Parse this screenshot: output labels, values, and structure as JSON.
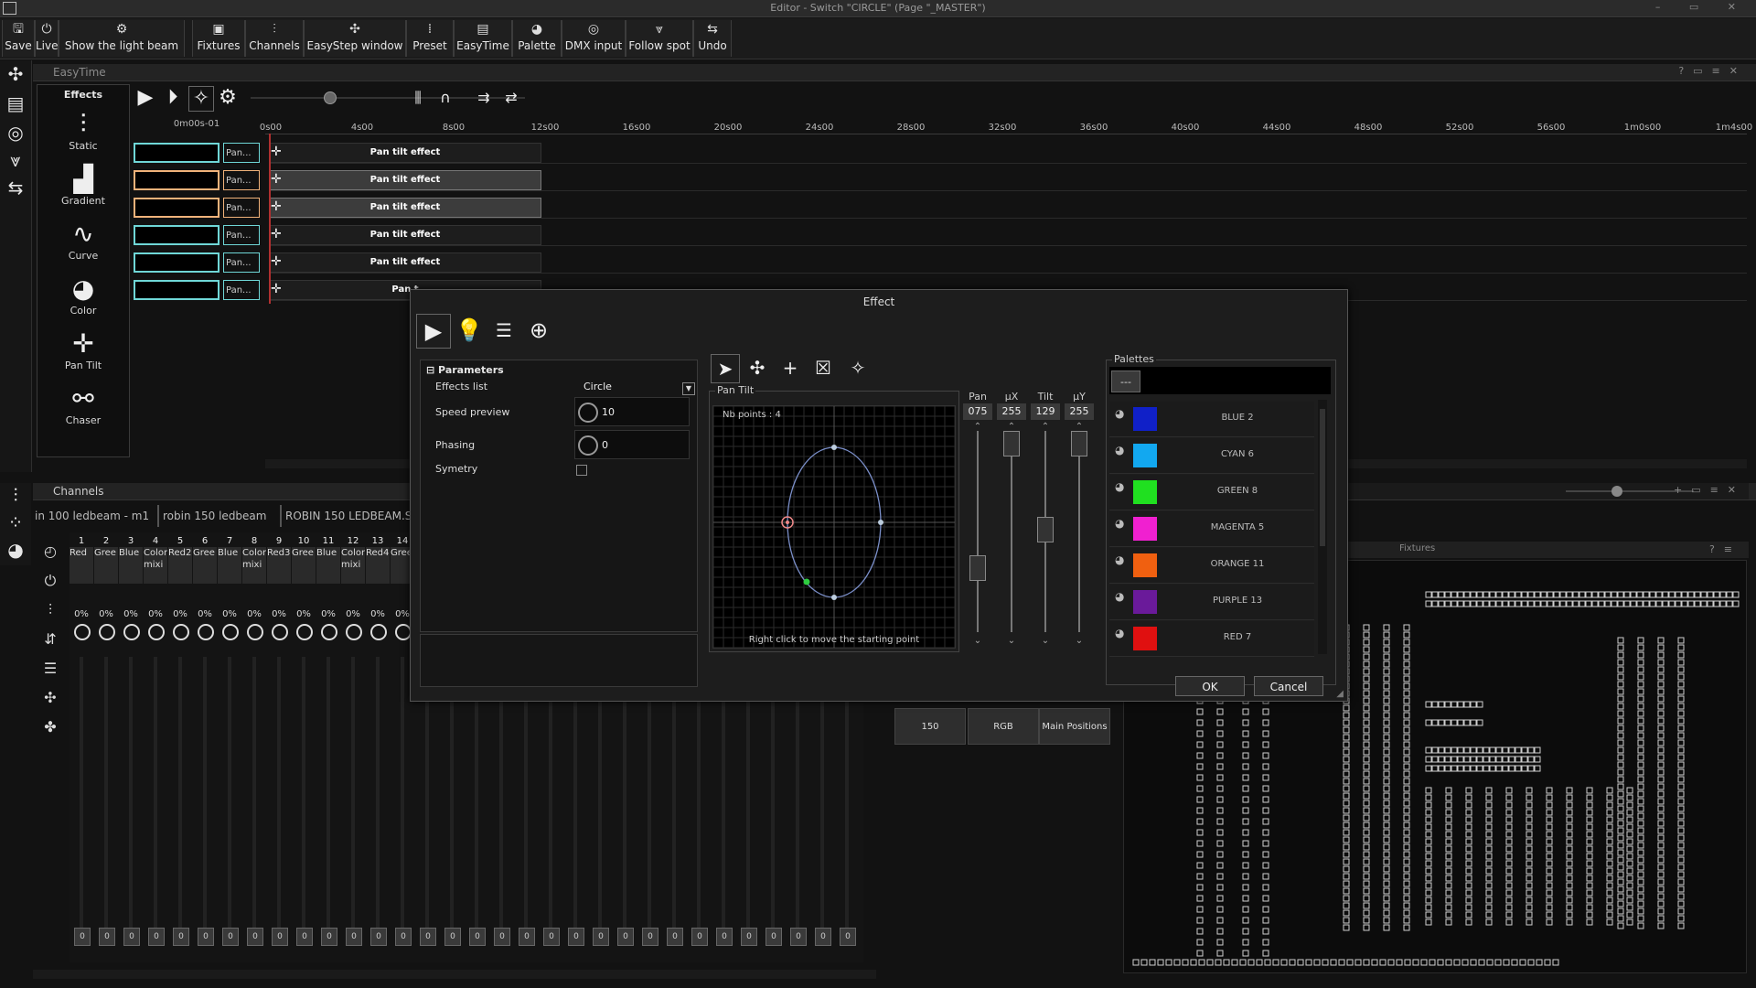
{
  "window": {
    "title": "Editor - Switch \"CIRCLE\" (Page \"_MASTER\")",
    "controls": "–  ▭  ✕"
  },
  "toolbar": [
    {
      "label": "Save",
      "icon": "🖫",
      "name": "save"
    },
    {
      "label": "Live",
      "icon": "⏻",
      "name": "live"
    },
    {
      "label": "Show the light beam",
      "icon": "⚙",
      "name": "show-light-beam"
    },
    {
      "label": "Fixtures",
      "icon": "▣",
      "name": "fixtures"
    },
    {
      "label": "Channels",
      "icon": "⫶",
      "name": "channels"
    },
    {
      "label": "EasyStep window",
      "icon": "✣",
      "name": "easystep-window"
    },
    {
      "label": "Preset",
      "icon": "⁞",
      "name": "preset"
    },
    {
      "label": "EasyTime",
      "icon": "▤",
      "name": "easytime"
    },
    {
      "label": "Palette",
      "icon": "◕",
      "name": "palette"
    },
    {
      "label": "DMX input",
      "icon": "◎",
      "name": "dmx-input"
    },
    {
      "label": "Follow spot",
      "icon": "⩔",
      "name": "follow-spot"
    },
    {
      "label": "Undo",
      "icon": "⇆",
      "name": "undo"
    }
  ],
  "easytime": {
    "title": "EasyTime",
    "timecode": "0m00s-01",
    "effects_header": "Effects",
    "effects": [
      {
        "label": "Static",
        "icon": "⫶"
      },
      {
        "label": "Gradient",
        "icon": "▟"
      },
      {
        "label": "Curve",
        "icon": "∿"
      },
      {
        "label": "Color",
        "icon": "◕"
      },
      {
        "label": "Pan Tilt",
        "icon": "✛"
      },
      {
        "label": "Chaser",
        "icon": "⚯"
      }
    ],
    "ruler": [
      "0s00",
      "4s00",
      "8s00",
      "12s00",
      "16s00",
      "20s00",
      "24s00",
      "28s00",
      "32s00",
      "36s00",
      "40s00",
      "44s00",
      "48s00",
      "52s00",
      "56s00",
      "1m0s00",
      "1m4s00"
    ],
    "tracks": [
      {
        "name": "Pan...",
        "effect": "Pan tilt effect",
        "border": "#6fd7d7",
        "highlight": false
      },
      {
        "name": "Pan...",
        "effect": "Pan tilt effect",
        "border": "#f0b27a",
        "highlight": true
      },
      {
        "name": "Pan...",
        "effect": "Pan tilt effect",
        "border": "#f0b27a",
        "highlight": true
      },
      {
        "name": "Pan...",
        "effect": "Pan tilt effect",
        "border": "#6fd7d7",
        "highlight": false
      },
      {
        "name": "Pan...",
        "effect": "Pan tilt effect",
        "border": "#6fd7d7",
        "highlight": false
      },
      {
        "name": "Pan...",
        "effect": "Pan t",
        "border": "#6fd7d7",
        "highlight": false
      }
    ]
  },
  "channels": {
    "title": "Channels",
    "tabs": [
      "in 100 ledbeam - m1",
      "robin 150 ledbeam",
      "ROBIN 150 LEDBEAM.SS"
    ],
    "list": [
      {
        "num": "1",
        "name": "Red"
      },
      {
        "num": "2",
        "name": "Gree"
      },
      {
        "num": "3",
        "name": "Blue"
      },
      {
        "num": "4",
        "name": "Color mixi"
      },
      {
        "num": "5",
        "name": "Red2"
      },
      {
        "num": "6",
        "name": "Gree"
      },
      {
        "num": "7",
        "name": "Blue"
      },
      {
        "num": "8",
        "name": "Color mixi"
      },
      {
        "num": "9",
        "name": "Red3"
      },
      {
        "num": "10",
        "name": "Gree"
      },
      {
        "num": "11",
        "name": "Blue"
      },
      {
        "num": "12",
        "name": "Color mixi"
      },
      {
        "num": "13",
        "name": "Red4"
      },
      {
        "num": "14",
        "name": "Gree"
      }
    ],
    "percent": "0%",
    "fader_value": "0"
  },
  "fixtures_panel": {
    "title": "Fixtures"
  },
  "presets": [
    {
      "label": "150"
    },
    {
      "label": "RGB"
    },
    {
      "label": "Main Positions"
    }
  ],
  "dialog": {
    "title": "Effect",
    "params_header": "Parameters",
    "effects_list_label": "Effects list",
    "effects_list_value": "Circle",
    "speed_label": "Speed preview",
    "speed_value": "10",
    "phasing_label": "Phasing",
    "phasing_value": "0",
    "symetry_label": "Symetry",
    "pan_tilt_label": "Pan Tilt",
    "nb_points": "Nb points : 4",
    "hint": "Right click to move the starting point",
    "sliders": [
      {
        "head": "Pan",
        "value": "075",
        "level": 0.29
      },
      {
        "head": "µX",
        "value": "255",
        "level": 1.0
      },
      {
        "head": "Tilt",
        "value": "129",
        "level": 0.51
      },
      {
        "head": "µY",
        "value": "255",
        "level": 1.0
      }
    ],
    "palettes_label": "Palettes",
    "palette_button": "---",
    "palettes": [
      {
        "name": "BLUE 2",
        "color": "#1020c8"
      },
      {
        "name": "CYAN 6",
        "color": "#12a8f0"
      },
      {
        "name": "GREEN 8",
        "color": "#20e020"
      },
      {
        "name": "MAGENTA 5",
        "color": "#f020d0"
      },
      {
        "name": "ORANGE 11",
        "color": "#f06010"
      },
      {
        "name": "PURPLE 13",
        "color": "#6a1a9a"
      },
      {
        "name": "RED 7",
        "color": "#e01010"
      }
    ],
    "ok": "OK",
    "cancel": "Cancel"
  }
}
